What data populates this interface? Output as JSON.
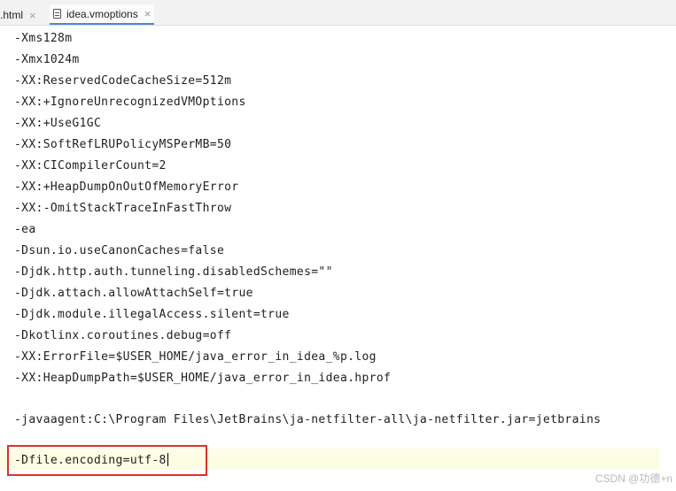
{
  "tabs": [
    {
      "label": ".html",
      "active": false
    },
    {
      "label": "idea.vmoptions",
      "active": true
    }
  ],
  "tab_close_glyph": "×",
  "editor": {
    "lines": [
      "-Xms128m",
      "-Xmx1024m",
      "-XX:ReservedCodeCacheSize=512m",
      "-XX:+IgnoreUnrecognizedVMOptions",
      "-XX:+UseG1GC",
      "-XX:SoftRefLRUPolicyMSPerMB=50",
      "-XX:CICompilerCount=2",
      "-XX:+HeapDumpOnOutOfMemoryError",
      "-XX:-OmitStackTraceInFastThrow",
      "-ea",
      "-Dsun.io.useCanonCaches=false",
      "-Djdk.http.auth.tunneling.disabledSchemes=\"\"",
      "-Djdk.attach.allowAttachSelf=true",
      "-Djdk.module.illegalAccess.silent=true",
      "-Dkotlinx.coroutines.debug=off",
      "-XX:ErrorFile=$USER_HOME/java_error_in_idea_%p.log",
      "-XX:HeapDumpPath=$USER_HOME/java_error_in_idea.hprof",
      "-javaagent:C:\\Program Files\\JetBrains\\ja-netfilter-all\\ja-netfilter.jar=jetbrains",
      "-Dfile.encoding=utf-8"
    ]
  },
  "annotation_color": "#d9322a",
  "watermark": "CSDN @功德+n"
}
